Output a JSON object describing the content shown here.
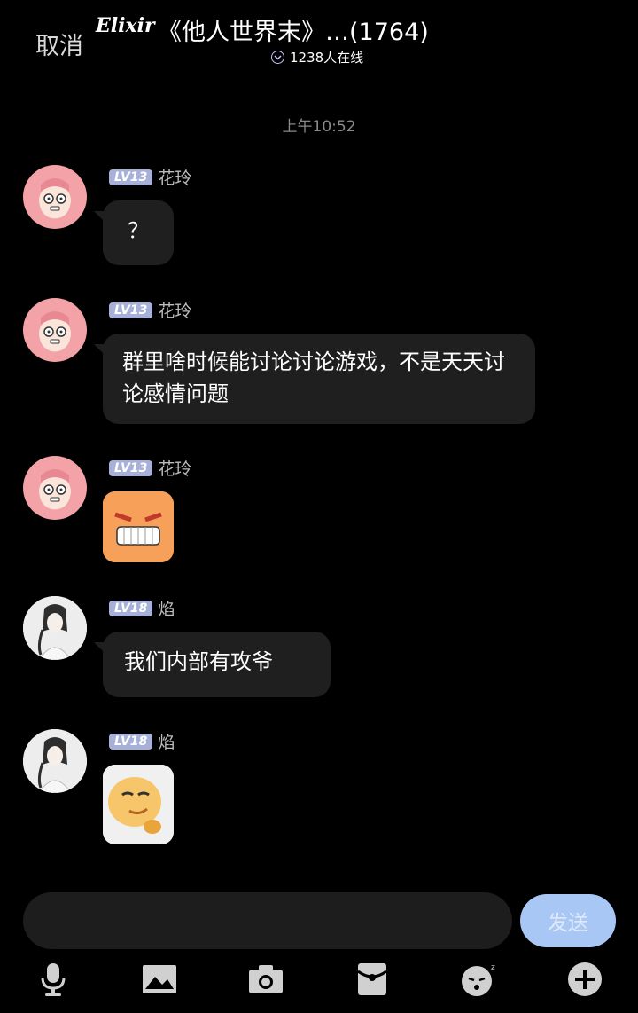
{
  "header": {
    "cancel_label": "取消",
    "brand": "Elixir",
    "title": "《他人世界末》…(1764)",
    "online_text": "1238人在线"
  },
  "timestamp": "上午10:52",
  "messages": [
    {
      "level": "LV13",
      "nick": "花玲",
      "text": "？",
      "avatar": "pink-hair-avatar"
    },
    {
      "level": "LV13",
      "nick": "花玲",
      "text": "群里啥时候能讨论讨论游戏，不是天天讨论感情问题",
      "avatar": "pink-hair-avatar"
    },
    {
      "level": "LV13",
      "nick": "花玲",
      "text": "",
      "sticker": "angry-face-sticker",
      "avatar": "pink-hair-avatar"
    },
    {
      "level": "LV18",
      "nick": "焰",
      "text": "我们内部有攻爷",
      "avatar": "ink-portrait-avatar"
    },
    {
      "level": "LV18",
      "nick": "焰",
      "text": "",
      "sticker": "smug-face-sticker",
      "avatar": "ink-portrait-avatar"
    }
  ],
  "composer": {
    "placeholder": "",
    "send_label": "发送"
  },
  "toolbar": {
    "icons": [
      "microphone-icon",
      "image-icon",
      "camera-icon",
      "red-packet-icon",
      "sticker-icon",
      "plus-icon"
    ]
  },
  "colors": {
    "background": "#000000",
    "bubble": "#1f1f1f",
    "level_badge": "#a7b0d9",
    "send_button": "#a8c7f5"
  }
}
